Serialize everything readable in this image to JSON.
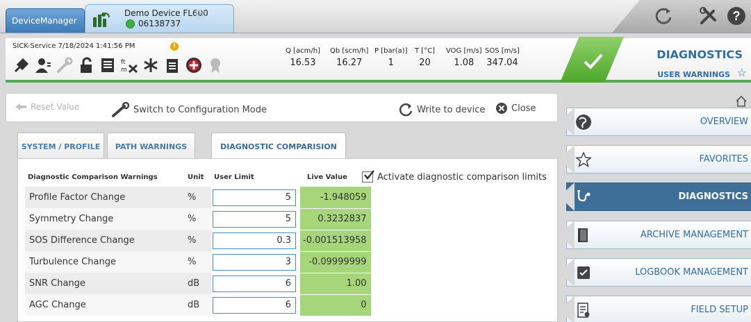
{
  "app": {
    "tab_label": "DeviceManager",
    "device_name": "Demo Device FL600",
    "device_serial": "06138737",
    "close_glyph": "×"
  },
  "header": {
    "user_time": "SICK-Service  7/18/2024 1:41:56 PM",
    "warning_glyph": "!",
    "measurements": [
      {
        "label": "Q [acm/h]",
        "value": "16.53"
      },
      {
        "label": "Qb [scm/h]",
        "value": "16.27"
      },
      {
        "label": "P [bar(a)]",
        "value": "1"
      },
      {
        "label": "T [°C]",
        "value": "20"
      },
      {
        "label": "VOG [m/s]",
        "value": "1.08"
      },
      {
        "label": "SOS [m/s]",
        "value": "347.04"
      }
    ],
    "title": "DIAGNOSTICS",
    "subtitle": "USER WARNINGS",
    "star_glyph": "☆",
    "status_color": "#57a85a"
  },
  "actions": {
    "reset": "Reset Value",
    "switch": "Switch to Configuration Mode",
    "write": "Write to device",
    "close": "Close"
  },
  "tabs": [
    {
      "label": "SYSTEM / PROFILE"
    },
    {
      "label": "PATH WARNINGS"
    },
    {
      "label": "DIAGNOSTIC COMPARISION"
    }
  ],
  "table": {
    "headers": {
      "name": "Diagnostic Comparison Warnings",
      "unit": "Unit",
      "limit": "User Limit",
      "live": "Live Value"
    },
    "rows": [
      {
        "name": "Profile Factor Change",
        "unit": "%",
        "limit": "5",
        "live": "-1.948059"
      },
      {
        "name": "Symmetry Change",
        "unit": "%",
        "limit": "5",
        "live": "0.3232837"
      },
      {
        "name": "SOS Difference Change",
        "unit": "%",
        "limit": "0.3",
        "live": "-0.001513958"
      },
      {
        "name": "Turbulence Change",
        "unit": "%",
        "limit": "3",
        "live": "-0.09999999"
      },
      {
        "name": "SNR Change",
        "unit": "dB",
        "limit": "6",
        "live": "1.00"
      },
      {
        "name": "AGC Change",
        "unit": "dB",
        "limit": "6",
        "live": "0"
      }
    ]
  },
  "activate_label": "Activate diagnostic comparison limits",
  "nav": [
    {
      "label": "OVERVIEW",
      "icon": "globe-icon"
    },
    {
      "label": "FAVORITES",
      "icon": "star-icon"
    },
    {
      "label": "DIAGNOSTICS",
      "icon": "stethoscope-icon"
    },
    {
      "label": "ARCHIVE MANAGEMENT",
      "icon": "book-icon"
    },
    {
      "label": "LOGBOOK MANAGEMENT",
      "icon": "logbook-icon"
    },
    {
      "label": "FIELD SETUP",
      "icon": "checklist-icon"
    }
  ],
  "colors": {
    "accent": "#2f6ea7",
    "live_value_bg": "#a7d57a",
    "nav_active": "#3e6f98"
  }
}
